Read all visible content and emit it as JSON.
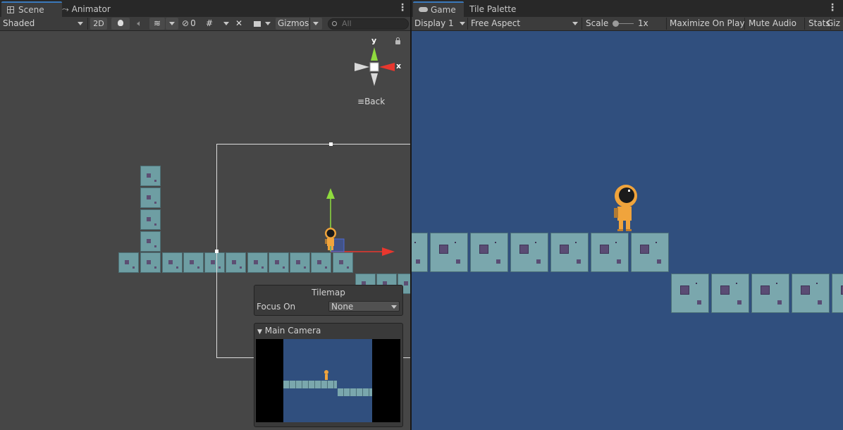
{
  "scene_tabs": {
    "scene_label": "Scene",
    "animator_label": "Animator"
  },
  "game_tabs": {
    "game_label": "Game",
    "tile_palette_label": "Tile Palette"
  },
  "scene_toolbar": {
    "shading_mode": "Shaded",
    "mode_2d": "2D",
    "hidden_count": "0",
    "gizmos_label": "Gizmos",
    "search_placeholder": "All"
  },
  "game_toolbar": {
    "display": "Display 1",
    "aspect": "Free Aspect",
    "scale_label": "Scale",
    "scale_value": "1x",
    "maximize_label": "Maximize On Play",
    "mute_label": "Mute Audio",
    "stats_label": "Stats",
    "gizmos_label": "Giz"
  },
  "orientation_gizmo": {
    "y_label": "y",
    "x_label": "x",
    "back_label": "Back"
  },
  "tilemap_overlay": {
    "title": "Tilemap",
    "focus_label": "Focus On",
    "focus_value": "None"
  },
  "camera_preview": {
    "title": "Main Camera"
  },
  "colors": {
    "scene_bg": "#464646",
    "game_bg": "#304f7e",
    "tile": "#7aa7ad",
    "tile_dot": "#5a4c74",
    "player": "#f0a43c",
    "accent_tab": "#3a79bb",
    "gizmo_y": "#8fdb3e",
    "gizmo_x": "#e8372e"
  }
}
